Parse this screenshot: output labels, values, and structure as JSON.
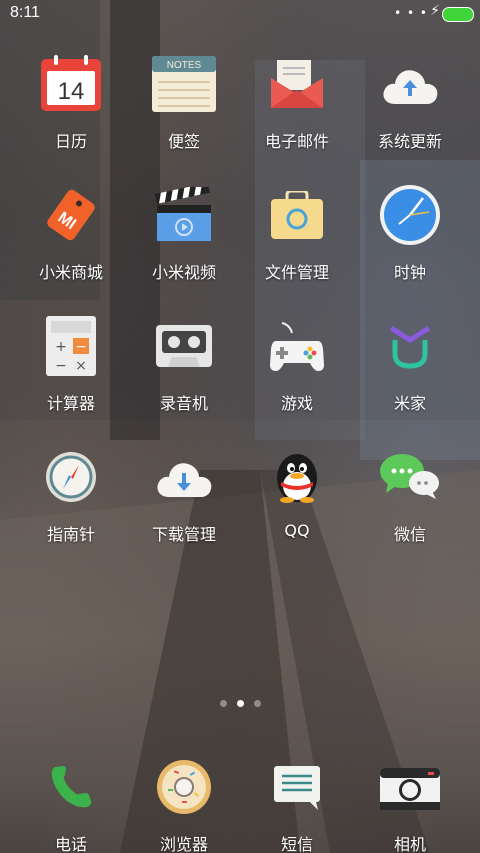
{
  "status_bar": {
    "time": "8:11",
    "signal_dots": "• • •",
    "charging_icon": "bolt-icon",
    "battery_color": "#3fd43a"
  },
  "apps": [
    {
      "label": "日历",
      "icon": "calendar-icon",
      "badge": "14"
    },
    {
      "label": "便签",
      "icon": "notes-icon",
      "badge": "NOTES"
    },
    {
      "label": "电子邮件",
      "icon": "email-icon"
    },
    {
      "label": "系统更新",
      "icon": "cloud-upload-icon"
    },
    {
      "label": "小米商城",
      "icon": "mi-tag-icon",
      "badge": "MI"
    },
    {
      "label": "小米视频",
      "icon": "video-clapper-icon"
    },
    {
      "label": "文件管理",
      "icon": "folder-icon"
    },
    {
      "label": "时钟",
      "icon": "clock-icon"
    },
    {
      "label": "计算器",
      "icon": "calculator-icon",
      "keys": [
        "+",
        "−",
        "−",
        "×"
      ]
    },
    {
      "label": "录音机",
      "icon": "cassette-icon"
    },
    {
      "label": "游戏",
      "icon": "gamepad-icon"
    },
    {
      "label": "米家",
      "icon": "mijia-icon"
    },
    {
      "label": "指南针",
      "icon": "compass-icon"
    },
    {
      "label": "下载管理",
      "icon": "cloud-download-icon"
    },
    {
      "label": "QQ",
      "icon": "qq-penguin-icon"
    },
    {
      "label": "微信",
      "icon": "wechat-icon"
    }
  ],
  "page_indicator": {
    "count": 3,
    "active_index": 1
  },
  "dock": [
    {
      "label": "电话",
      "icon": "phone-icon"
    },
    {
      "label": "浏览器",
      "icon": "donut-browser-icon"
    },
    {
      "label": "短信",
      "icon": "message-icon"
    },
    {
      "label": "相机",
      "icon": "camera-icon"
    }
  ],
  "colors": {
    "label_text": "#ffffff",
    "calendar_red": "#e8443a",
    "mi_orange": "#f0622a",
    "clock_blue": "#3a8ee6",
    "phone_green": "#3cb24a"
  }
}
